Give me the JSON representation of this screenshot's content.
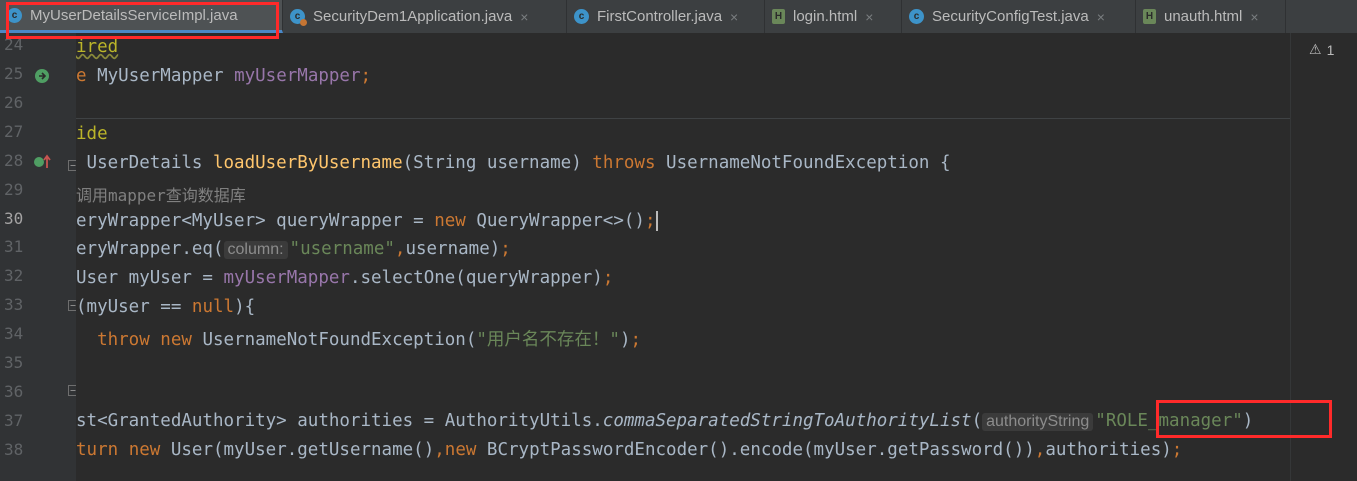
{
  "tabs": [
    {
      "label": "MyUserDetailsServiceImpl.java",
      "icon": "class-icon",
      "active": true
    },
    {
      "label": "SecurityDem1Application.java",
      "icon": "spring-app-class-icon",
      "active": false
    },
    {
      "label": "FirstController.java",
      "icon": "class-icon",
      "active": false
    },
    {
      "label": "login.html",
      "icon": "html-file-icon",
      "active": false
    },
    {
      "label": "SecurityConfigTest.java",
      "icon": "class-icon",
      "active": false
    },
    {
      "label": "unauth.html",
      "icon": "html-file-icon",
      "active": false
    }
  ],
  "tab_close_glyph": "×",
  "tab_icon_letter_c": "c",
  "tab_icon_letter_h": "H",
  "editor": {
    "line_numbers": [
      "24",
      "25",
      "26",
      "27",
      "28",
      "29",
      "30",
      "31",
      "32",
      "33",
      "34",
      "35",
      "36",
      "37",
      "38"
    ],
    "current_line": "30",
    "inspection": {
      "icon": "warning-icon",
      "glyph": "⚠",
      "count": "1"
    },
    "code": {
      "l24": {
        "a": "ired"
      },
      "l25": {
        "a": "e",
        "b": " MyUserMapper ",
        "c": "myUserMapper",
        "d": ";"
      },
      "l27": {
        "a": "ide"
      },
      "l28": {
        "a": " UserDetails ",
        "b": "loadUserByUsername",
        "c": "(String username) ",
        "d": "throws",
        "e": " UsernameNotFoundException {"
      },
      "l29": {
        "a": "调用mapper查询数据库"
      },
      "l30": {
        "a": "eryWrapper<MyUser> queryWrapper = ",
        "b": "new",
        "c": " QueryWrapper<>()",
        "d": ";"
      },
      "l31": {
        "a": "eryWrapper.eq(",
        "hint": "column:",
        "b": "\"username\"",
        "c": ",",
        "d": "username)",
        "e": ";"
      },
      "l32": {
        "a": "User myUser = ",
        "b": "myUserMapper",
        "c": ".selectOne(queryWrapper)",
        "d": ";"
      },
      "l33": {
        "a": "(myUser == ",
        "b": "null",
        "c": "){"
      },
      "l34": {
        "a": "  ",
        "b": "throw new",
        "c": " UsernameNotFoundException(",
        "d": "\"用户名不存在！\"",
        "e": ")",
        "f": ";"
      },
      "l37": {
        "a": "st<GrantedAuthority> authorities = AuthorityUtils.",
        "b": "commaSeparatedStringToAuthorityList",
        "c": "(",
        "hint": "authorityString",
        "d": "\"ROLE_manager\"",
        "e": ")"
      },
      "l38": {
        "a": "turn ",
        "b": "new",
        "c": " User(myUser.getUsername()",
        "d": ",",
        "e": "new",
        "f": " BCryptPasswordEncoder().encode(myUser.getPassword())",
        "g": ",",
        "h": "authorities)",
        "i": ";"
      }
    }
  },
  "gutter_icons": {
    "line25": "bean-navigation-icon",
    "line28": "override-method-icon"
  },
  "highlights": {
    "color": "#ff2a2a",
    "targets": [
      "active-tab",
      "role-manager-string"
    ]
  }
}
